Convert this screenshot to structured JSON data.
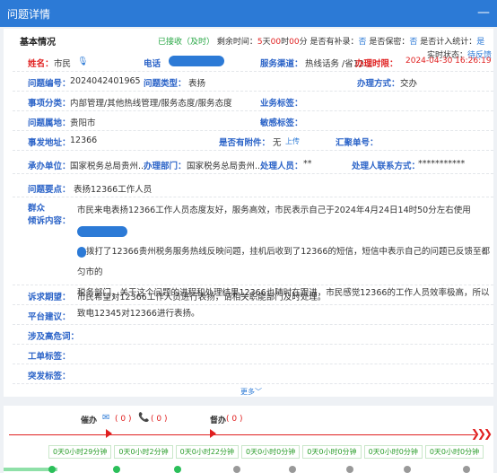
{
  "window": {
    "title": "问题详情",
    "minimize": "—"
  },
  "basic": {
    "title": "基本情况",
    "accept_status": "已接收（及时）",
    "remaining_label": "剩余时间：",
    "remaining": {
      "d": "5",
      "d_unit": "天",
      "h": "00",
      "h_unit": "时",
      "m": "00",
      "m_unit": "分"
    },
    "supplement_label": "是否有补录：",
    "supplement_value": "否",
    "secret_label": "是否保密：",
    "secret_value": "否",
    "stats_label": "是否计入统计：",
    "stats_value": "是",
    "realtime_label": "实时状态：",
    "realtime_value": "待反馈"
  },
  "fields": {
    "name_label": "姓名：",
    "name_value": "市民",
    "phone_label": "电话",
    "channel_label": "服务渠道：",
    "channel_value": "热线话务 /省12...",
    "deadline_label": "办理时限：",
    "deadline_value": "2024-04-30 16:26:19",
    "number_label": "问题编号：",
    "number_value": "2024042401965",
    "type_label": "问题类型：",
    "type_value": "表扬",
    "method_label": "办理方式：",
    "method_value": "交办",
    "category_label": "事项分类：",
    "category_value": "内部管理/其他热线管理/服务态度/服务态度",
    "biztag_label": "业务标签：",
    "biztag_value": "",
    "location_label": "问题属地：",
    "location_value": "贵阳市",
    "sensitive_label": "敏感标签：",
    "sensitive_value": "",
    "address_label": "事发地址：",
    "address_value": "12366",
    "attach_label": "是否有附件：",
    "attach_value": "无",
    "attach_upload": "上传",
    "merge_label": "汇聚单号：",
    "merge_value": "",
    "org_label": "承办单位：",
    "org_value": "国家税务总局贵州...",
    "dept_label": "办理部门：",
    "dept_value": "国家税务总局贵州...",
    "handler_label": "处理人员：",
    "handler_value": "**",
    "handler_contact_label": "处理人联系方式：",
    "handler_contact_value": "***********",
    "keypoint_label": "问题要点：",
    "keypoint_value": "表扬12366工作人员",
    "content_label_1": "群众",
    "content_label_2": "倾诉内容：",
    "content_line1": "市民来电表扬12366工作人员态度友好，服务高效，市民表示自己于2024年4月24日14时50分左右使用",
    "content_line2": "拨打了12366贵州税务服务热线反映问题，挂机后收到了12366的短信，短信中表示自己的问题已反馈至都匀市的",
    "content_line3": "税务部门，关于这个问题的进程和处理结果12366也随时在跟进，市民感觉12366的工作人员效率极高，所以",
    "content_line4": "致电12345对12366进行表扬。",
    "expect_label": "诉求期望：",
    "expect_value": "市民希望对12366工作人员进行表扬，请相关职能部门及时处理。",
    "platform_label": "平台建议：",
    "risk_label": "涉及高危词：",
    "worktag_label": "工单标签：",
    "event_label": "突发标签：",
    "more": "更多"
  },
  "timeline": {
    "urge_label": "催办",
    "urge_mail_count": "( 0 )",
    "urge_phone_count": "( 0 )",
    "supervise_label": "督办",
    "supervise_count": "( 0 )",
    "durations": [
      "0天0小时29分钟",
      "0天0小时2分钟",
      "0天0小时22分钟",
      "0天0小时0分钟",
      "0天0小时0分钟",
      "0天0小时0分钟",
      "0天0小时0分钟"
    ]
  }
}
